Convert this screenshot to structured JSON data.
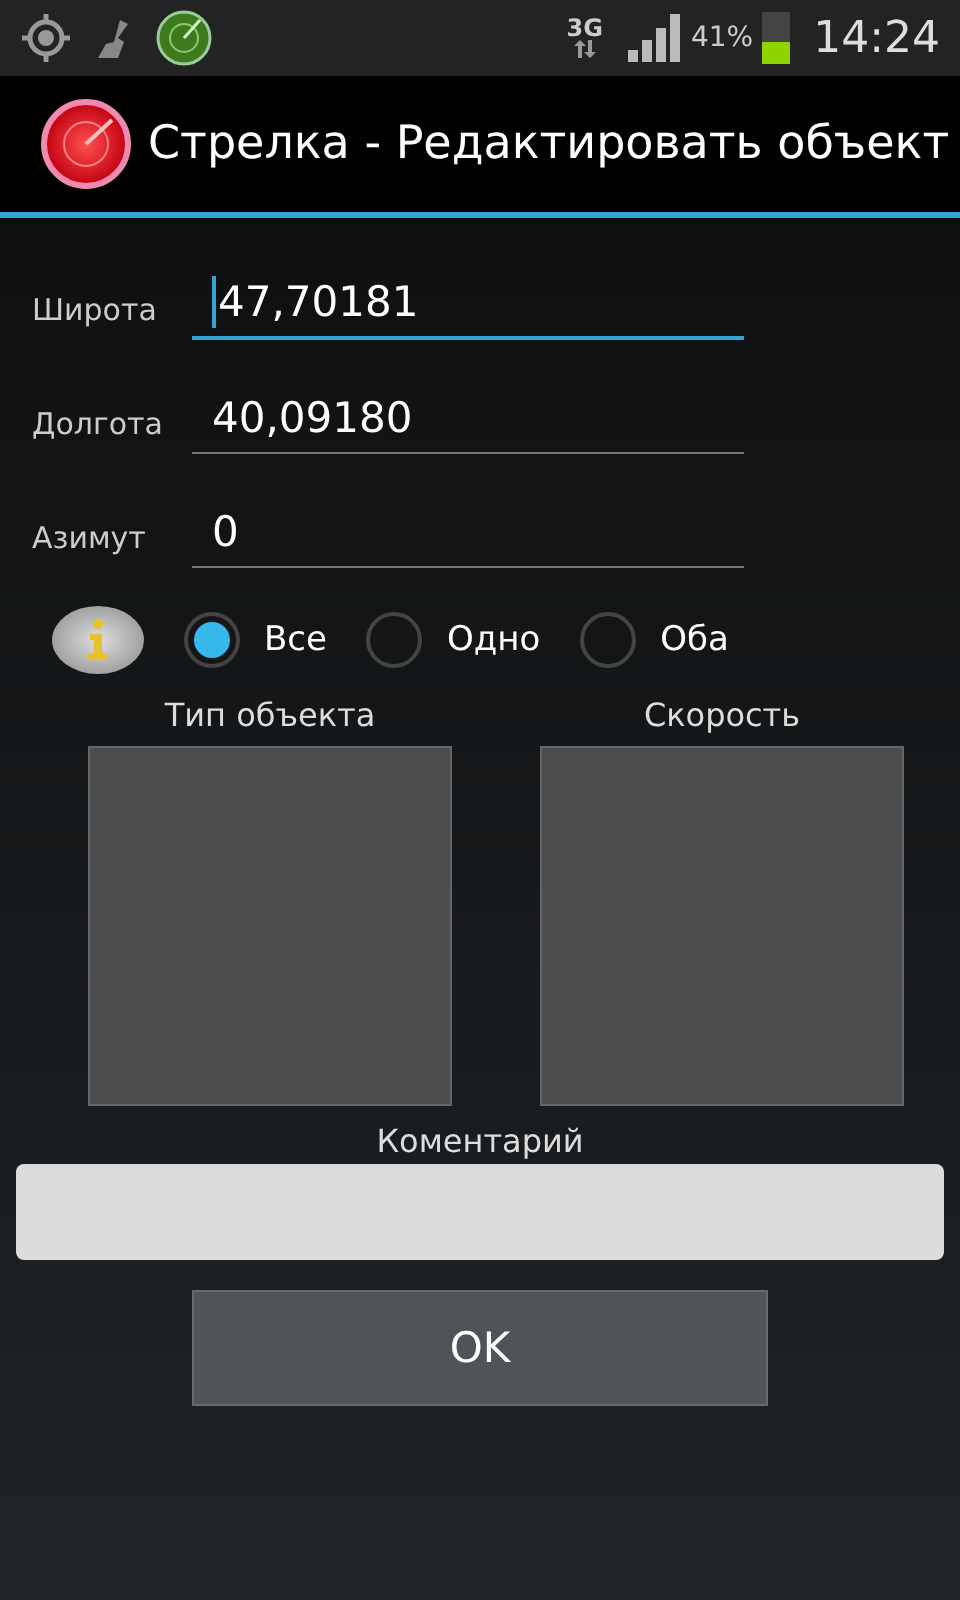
{
  "status_bar": {
    "network": "3G",
    "battery": {
      "text": "41%",
      "level": 0.41
    },
    "time": "14:24"
  },
  "window": {
    "title": "Стрелка - Редактировать объект"
  },
  "fields": [
    {
      "label": "Широта",
      "value": "47,70181",
      "focused": true
    },
    {
      "label": "Долгота",
      "value": "40,09180",
      "focused": false
    },
    {
      "label": "Азимут",
      "value": "0",
      "focused": false
    }
  ],
  "radios": [
    {
      "label": "Все",
      "selected": true
    },
    {
      "label": "Одно",
      "selected": false
    },
    {
      "label": "Оба",
      "selected": false
    }
  ],
  "lists": [
    {
      "label": "Тип объекта"
    },
    {
      "label": "Скорость"
    }
  ],
  "comment": {
    "label": "Коментарий"
  },
  "buttons": [
    "OK"
  ]
}
